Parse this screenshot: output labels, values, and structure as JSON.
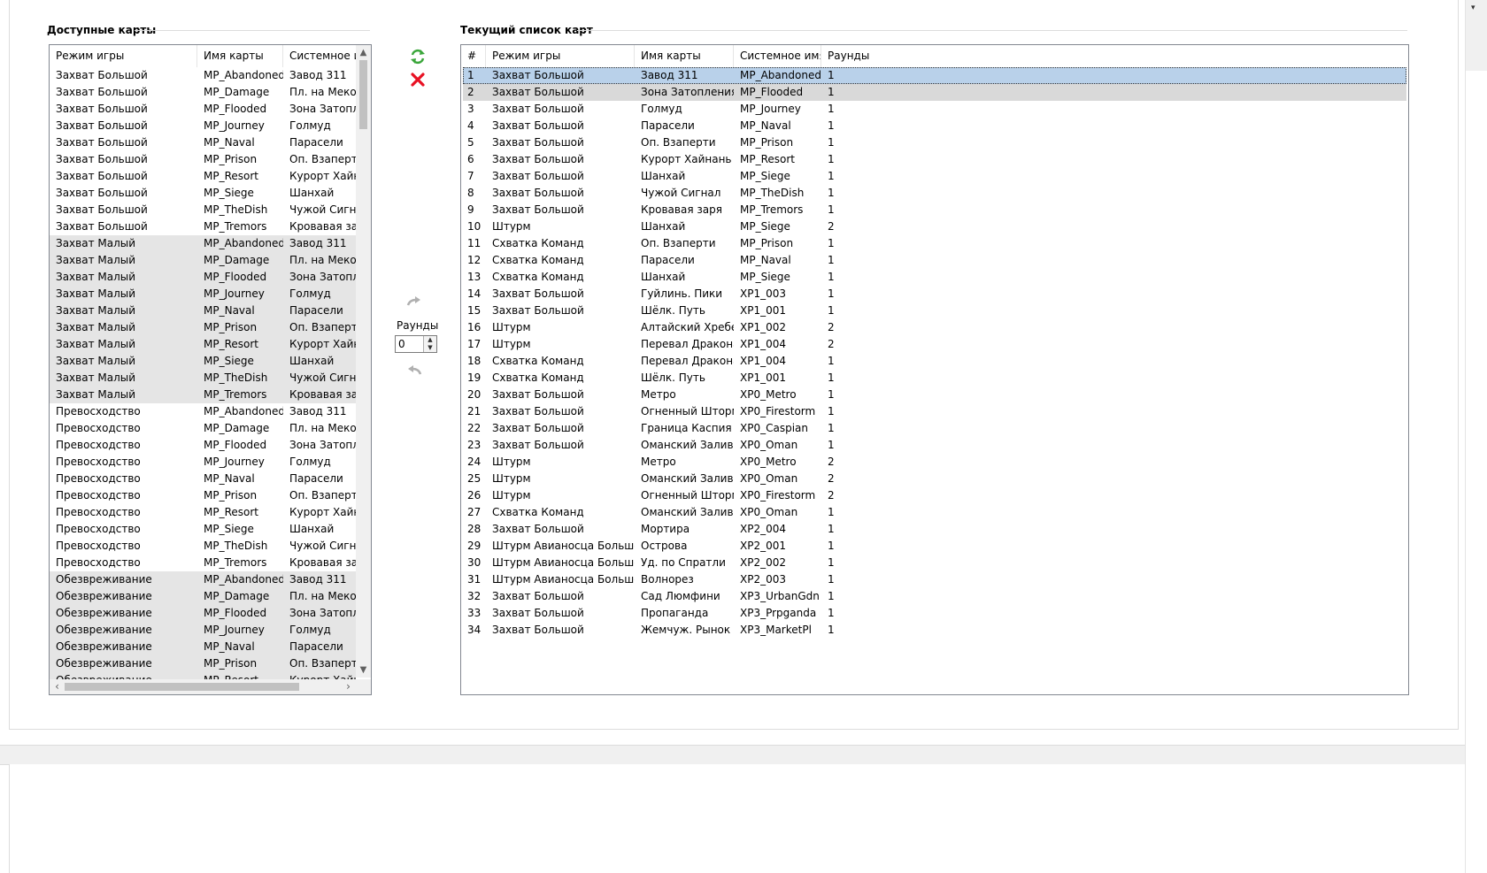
{
  "available": {
    "title": "Доступные карты",
    "columns": [
      "Режим игры",
      "Имя карты",
      "Системное им"
    ],
    "rows": [
      [
        "Захват Большой",
        "MP_Abandoned",
        "Завод 311"
      ],
      [
        "Захват Большой",
        "MP_Damage",
        "Пл. на Меконге"
      ],
      [
        "Захват Большой",
        "MP_Flooded",
        "Зона Затопления"
      ],
      [
        "Захват Большой",
        "MP_Journey",
        "Голмуд"
      ],
      [
        "Захват Большой",
        "MP_Naval",
        "Парасели"
      ],
      [
        "Захват Большой",
        "MP_Prison",
        "Оп. Взаперти"
      ],
      [
        "Захват Большой",
        "MP_Resort",
        "Курорт Хайнань"
      ],
      [
        "Захват Большой",
        "MP_Siege",
        "Шанхай"
      ],
      [
        "Захват Большой",
        "MP_TheDish",
        "Чужой Сигнал"
      ],
      [
        "Захват Большой",
        "MP_Tremors",
        "Кровавая заря"
      ],
      [
        "Захват Малый",
        "MP_Abandoned",
        "Завод 311"
      ],
      [
        "Захват Малый",
        "MP_Damage",
        "Пл. на Меконге"
      ],
      [
        "Захват Малый",
        "MP_Flooded",
        "Зона Затопления"
      ],
      [
        "Захват Малый",
        "MP_Journey",
        "Голмуд"
      ],
      [
        "Захват Малый",
        "MP_Naval",
        "Парасели"
      ],
      [
        "Захват Малый",
        "MP_Prison",
        "Оп. Взаперти"
      ],
      [
        "Захват Малый",
        "MP_Resort",
        "Курорт Хайнань"
      ],
      [
        "Захват Малый",
        "MP_Siege",
        "Шанхай"
      ],
      [
        "Захват Малый",
        "MP_TheDish",
        "Чужой Сигнал"
      ],
      [
        "Захват Малый",
        "MP_Tremors",
        "Кровавая заря"
      ],
      [
        "Превосходство",
        "MP_Abandoned",
        "Завод 311"
      ],
      [
        "Превосходство",
        "MP_Damage",
        "Пл. на Меконге"
      ],
      [
        "Превосходство",
        "MP_Flooded",
        "Зона Затопления"
      ],
      [
        "Превосходство",
        "MP_Journey",
        "Голмуд"
      ],
      [
        "Превосходство",
        "MP_Naval",
        "Парасели"
      ],
      [
        "Превосходство",
        "MP_Prison",
        "Оп. Взаперти"
      ],
      [
        "Превосходство",
        "MP_Resort",
        "Курорт Хайнань"
      ],
      [
        "Превосходство",
        "MP_Siege",
        "Шанхай"
      ],
      [
        "Превосходство",
        "MP_TheDish",
        "Чужой Сигнал"
      ],
      [
        "Превосходство",
        "MP_Tremors",
        "Кровавая заря"
      ],
      [
        "Обезвреживание",
        "MP_Abandoned",
        "Завод 311"
      ],
      [
        "Обезвреживание",
        "MP_Damage",
        "Пл. на Меконге"
      ],
      [
        "Обезвреживание",
        "MP_Flooded",
        "Зона Затопления"
      ],
      [
        "Обезвреживание",
        "MP_Journey",
        "Голмуд"
      ],
      [
        "Обезвреживание",
        "MP_Naval",
        "Парасели"
      ],
      [
        "Обезвреживание",
        "MP_Prison",
        "Оп. Взаперти"
      ],
      [
        "Обезвреживание",
        "MP_Resort",
        "Курорт Хайнань"
      ]
    ]
  },
  "controls": {
    "refresh_icon": "refresh-icon",
    "delete_icon": "delete-icon",
    "add_icon": "arrow-right-icon",
    "remove_icon": "arrow-left-icon",
    "rounds_label": "Раунды",
    "rounds_value": "0"
  },
  "current": {
    "title": "Текущий список карт",
    "columns": [
      "#",
      "Режим игры",
      "Имя карты",
      "Системное имя",
      "Раунды"
    ],
    "rows": [
      [
        "1",
        "Захват Большой",
        "Завод 311",
        "MP_Abandoned",
        "1"
      ],
      [
        "2",
        "Захват Большой",
        "Зона Затопления",
        "MP_Flooded",
        "1"
      ],
      [
        "3",
        "Захват Большой",
        "Голмуд",
        "MP_Journey",
        "1"
      ],
      [
        "4",
        "Захват Большой",
        "Парасели",
        "MP_Naval",
        "1"
      ],
      [
        "5",
        "Захват Большой",
        "Оп. Взаперти",
        "MP_Prison",
        "1"
      ],
      [
        "6",
        "Захват Большой",
        "Курорт Хайнань",
        "MP_Resort",
        "1"
      ],
      [
        "7",
        "Захват Большой",
        "Шанхай",
        "MP_Siege",
        "1"
      ],
      [
        "8",
        "Захват Большой",
        "Чужой Сигнал",
        "MP_TheDish",
        "1"
      ],
      [
        "9",
        "Захват Большой",
        "Кровавая заря",
        "MP_Tremors",
        "1"
      ],
      [
        "10",
        "Штурм",
        "Шанхай",
        "MP_Siege",
        "2"
      ],
      [
        "11",
        "Схватка Команд",
        "Оп. Взаперти",
        "MP_Prison",
        "1"
      ],
      [
        "12",
        "Схватка Команд",
        "Парасели",
        "MP_Naval",
        "1"
      ],
      [
        "13",
        "Схватка Команд",
        "Шанхай",
        "MP_Siege",
        "1"
      ],
      [
        "14",
        "Захват Большой",
        "Гуйлинь. Пики",
        "XP1_003",
        "1"
      ],
      [
        "15",
        "Захват Большой",
        "Шёлк. Путь",
        "XP1_001",
        "1"
      ],
      [
        "16",
        "Штурм",
        "Алтайский Хребет",
        "XP1_002",
        "2"
      ],
      [
        "17",
        "Штурм",
        "Перевал Дракона",
        "XP1_004",
        "2"
      ],
      [
        "18",
        "Схватка Команд",
        "Перевал Дракона",
        "XP1_004",
        "1"
      ],
      [
        "19",
        "Схватка Команд",
        "Шёлк. Путь",
        "XP1_001",
        "1"
      ],
      [
        "20",
        "Захват Большой",
        "Метро",
        "XP0_Metro",
        "1"
      ],
      [
        "21",
        "Захват Большой",
        "Огненный Шторм",
        "XP0_Firestorm",
        "1"
      ],
      [
        "22",
        "Захват Большой",
        "Граница Каспия",
        "XP0_Caspian",
        "1"
      ],
      [
        "23",
        "Захват Большой",
        "Оманский Залив",
        "XP0_Oman",
        "1"
      ],
      [
        "24",
        "Штурм",
        "Метро",
        "XP0_Metro",
        "2"
      ],
      [
        "25",
        "Штурм",
        "Оманский Залив",
        "XP0_Oman",
        "2"
      ],
      [
        "26",
        "Штурм",
        "Огненный Шторм",
        "XP0_Firestorm",
        "2"
      ],
      [
        "27",
        "Схватка Команд",
        "Оманский Залив",
        "XP0_Oman",
        "1"
      ],
      [
        "28",
        "Захват Большой",
        "Мортира",
        "XP2_004",
        "1"
      ],
      [
        "29",
        "Штурм Авианосца Большой",
        "Острова",
        "XP2_001",
        "1"
      ],
      [
        "30",
        "Штурм Авианосца Большой",
        "Уд. по Спратли",
        "XP2_002",
        "1"
      ],
      [
        "31",
        "Штурм Авианосца Большой",
        "Волнорез",
        "XP2_003",
        "1"
      ],
      [
        "32",
        "Захват Большой",
        "Сад Люмфини",
        "XP3_UrbanGdn",
        "1"
      ],
      [
        "33",
        "Захват Большой",
        "Пропаганда",
        "XP3_Prpganda",
        "1"
      ],
      [
        "34",
        "Захват Большой",
        "Жемчуж. Рынок",
        "XP3_MarketPl",
        "1"
      ]
    ]
  },
  "colors": {
    "selected_row": "#b9d1ea",
    "secondary_selected_row": "#d9d9d9",
    "group_row_alt": "#e5e5e5",
    "delete_red": "#e81123",
    "refresh_green": "#3aa63a"
  }
}
